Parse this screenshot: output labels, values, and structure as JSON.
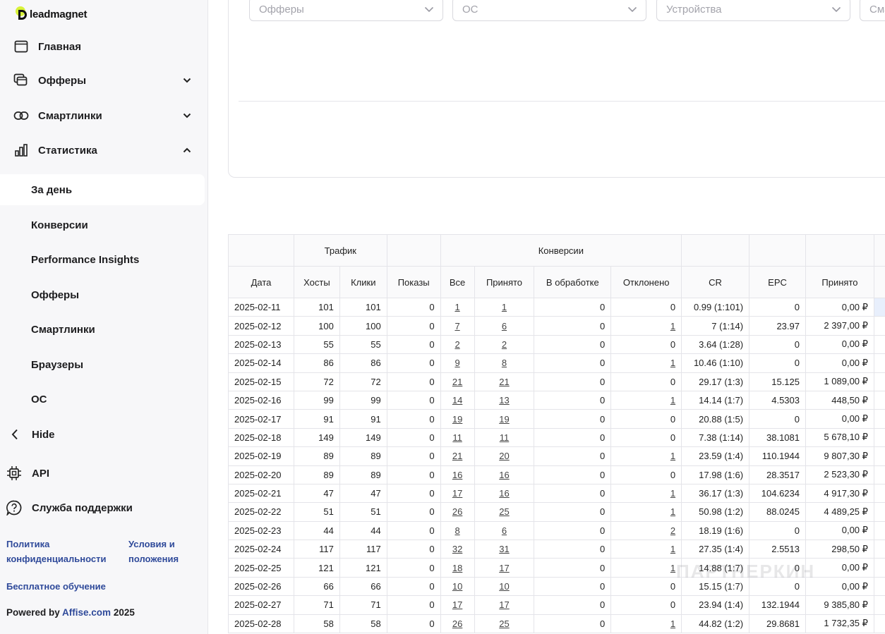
{
  "brand": {
    "name": "leadmagnet"
  },
  "sidebar": {
    "nav": [
      {
        "label": "Главная",
        "icon": "browser-window-icon"
      },
      {
        "label": "Офферы",
        "icon": "stacked-cards-icon"
      },
      {
        "label": "Смартлинки",
        "icon": "link-icon"
      },
      {
        "label": "Статистика",
        "icon": "bar-chart-icon"
      }
    ],
    "stats_sub": [
      {
        "label": "За день",
        "active": true
      },
      {
        "label": "Конверсии"
      },
      {
        "label": "Performance Insights"
      },
      {
        "label": "Офферы"
      },
      {
        "label": "Смартлинки"
      },
      {
        "label": "Браузеры"
      },
      {
        "label": "ОС"
      }
    ],
    "hide_label": "Hide",
    "api_label": "API",
    "support_label": "Служба поддержки",
    "footer": {
      "privacy_line1": "Политика",
      "privacy_line2": "конфиденциальности",
      "terms_line1": "Условия и",
      "terms_line2": "положения",
      "free_training": "Бесплатное обучение",
      "powered_prefix": "Powered by ",
      "powered_link": "Affise.com",
      "powered_year": " 2025"
    }
  },
  "filters": {
    "offers": "Офферы",
    "os": "ОС",
    "devices": "Устройства",
    "fourth": "Сма"
  },
  "table": {
    "group_headers": {
      "traffic": "Трафик",
      "conversions": "Конверсии"
    },
    "columns": [
      "Дата",
      "Хосты",
      "Клики",
      "Показы",
      "Все",
      "Принято",
      "В обработке",
      "Отклонено",
      "CR",
      "EPC",
      "Принято"
    ],
    "rows": [
      [
        "2025-02-11",
        "101",
        "101",
        "0",
        "1",
        "1",
        "0",
        "0",
        "0.99 (1:101)",
        "0",
        "0,00 ₽"
      ],
      [
        "2025-02-12",
        "100",
        "100",
        "0",
        "7",
        "6",
        "0",
        "1",
        "7 (1:14)",
        "23.97",
        "2 397,00 ₽"
      ],
      [
        "2025-02-13",
        "55",
        "55",
        "0",
        "2",
        "2",
        "0",
        "0",
        "3.64 (1:28)",
        "0",
        "0,00 ₽"
      ],
      [
        "2025-02-14",
        "86",
        "86",
        "0",
        "9",
        "8",
        "0",
        "1",
        "10.46 (1:10)",
        "0",
        "0,00 ₽"
      ],
      [
        "2025-02-15",
        "72",
        "72",
        "0",
        "21",
        "21",
        "0",
        "0",
        "29.17 (1:3)",
        "15.125",
        "1 089,00 ₽"
      ],
      [
        "2025-02-16",
        "99",
        "99",
        "0",
        "14",
        "13",
        "0",
        "1",
        "14.14 (1:7)",
        "4.5303",
        "448,50 ₽"
      ],
      [
        "2025-02-17",
        "91",
        "91",
        "0",
        "19",
        "19",
        "0",
        "0",
        "20.88 (1:5)",
        "0",
        "0,00 ₽"
      ],
      [
        "2025-02-18",
        "149",
        "149",
        "0",
        "11",
        "11",
        "0",
        "0",
        "7.38 (1:14)",
        "38.1081",
        "5 678,10 ₽"
      ],
      [
        "2025-02-19",
        "89",
        "89",
        "0",
        "21",
        "20",
        "0",
        "1",
        "23.59 (1:4)",
        "110.1944",
        "9 807,30 ₽"
      ],
      [
        "2025-02-20",
        "89",
        "89",
        "0",
        "16",
        "16",
        "0",
        "0",
        "17.98 (1:6)",
        "28.3517",
        "2 523,30 ₽"
      ],
      [
        "2025-02-21",
        "47",
        "47",
        "0",
        "17",
        "16",
        "0",
        "1",
        "36.17 (1:3)",
        "104.6234",
        "4 917,30 ₽"
      ],
      [
        "2025-02-22",
        "51",
        "51",
        "0",
        "26",
        "25",
        "0",
        "1",
        "50.98 (1:2)",
        "88.0245",
        "4 489,25 ₽"
      ],
      [
        "2025-02-23",
        "44",
        "44",
        "0",
        "8",
        "6",
        "0",
        "2",
        "18.19 (1:6)",
        "0",
        "0,00 ₽"
      ],
      [
        "2025-02-24",
        "117",
        "117",
        "0",
        "32",
        "31",
        "0",
        "1",
        "27.35 (1:4)",
        "2.5513",
        "298,50 ₽"
      ],
      [
        "2025-02-25",
        "121",
        "121",
        "0",
        "18",
        "17",
        "0",
        "1",
        "14.88 (1:7)",
        "0",
        "0,00 ₽"
      ],
      [
        "2025-02-26",
        "66",
        "66",
        "0",
        "10",
        "10",
        "0",
        "0",
        "15.15 (1:7)",
        "0",
        "0,00 ₽"
      ],
      [
        "2025-02-27",
        "71",
        "71",
        "0",
        "17",
        "17",
        "0",
        "0",
        "23.94 (1:4)",
        "132.1944",
        "9 385,80 ₽"
      ],
      [
        "2025-02-28",
        "58",
        "58",
        "0",
        "26",
        "25",
        "0",
        "1",
        "44.82 (1:2)",
        "29.8681",
        "1 732,35 ₽"
      ]
    ]
  },
  "watermark": "ПАРТНЕРКИН"
}
